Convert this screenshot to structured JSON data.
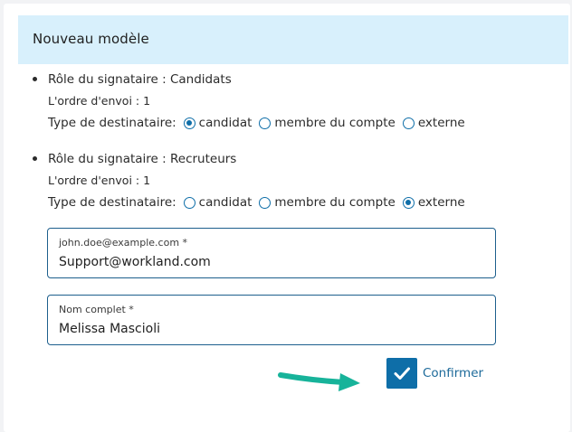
{
  "header": {
    "title": "Nouveau modèle"
  },
  "signers": [
    {
      "role_text": "Rôle du signataire : Candidats",
      "order_text": "L'ordre d'envoi : 1",
      "type_label": "Type de destinataire:",
      "options": [
        "candidat",
        "membre du compte",
        "externe"
      ],
      "selected": "candidat"
    },
    {
      "role_text": "Rôle du signataire : Recruteurs",
      "order_text": "L'ordre d'envoi : 1",
      "type_label": "Type de destinataire:",
      "options": [
        "candidat",
        "membre du compte",
        "externe"
      ],
      "selected": "externe"
    }
  ],
  "fields": {
    "email": {
      "label": "john.doe@example.com *",
      "value": "Support@workland.com"
    },
    "full_name": {
      "label": "Nom complet *",
      "value": "Melissa Mascioli"
    }
  },
  "confirm": {
    "label": "Confirmer",
    "icon": "check-icon"
  },
  "colors": {
    "accent": "#0e6ea8",
    "header_bg": "#d8f0fc",
    "arrow": "#17b39a"
  }
}
